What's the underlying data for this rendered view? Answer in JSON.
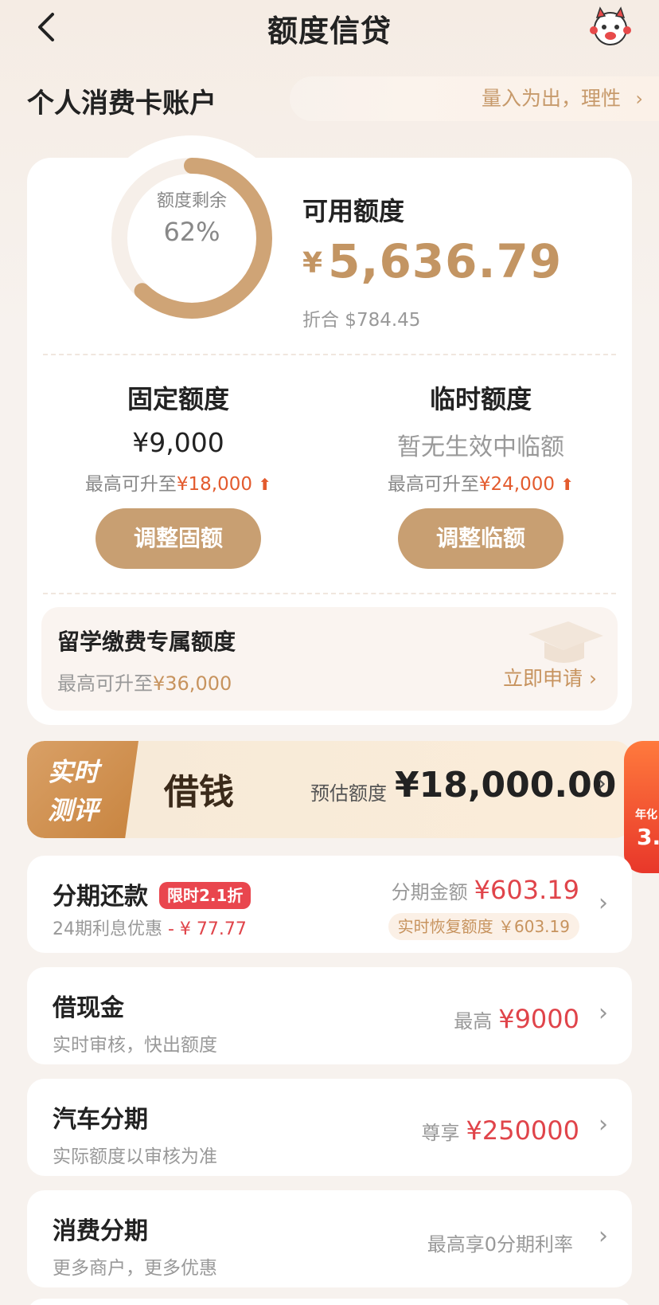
{
  "header": {
    "title": "额度信贷"
  },
  "account": {
    "title": "个人消费卡账户",
    "slogan": "量入为出，理性"
  },
  "credit": {
    "ring_label": "额度剩余",
    "ring_percent": "62%",
    "ring_fraction": 0.62,
    "available_label": "可用额度",
    "currency_symbol": "¥",
    "available_amount": "5,636.79",
    "usd_label": "折合 $784.45",
    "fixed": {
      "title": "固定额度",
      "value": "¥9,000",
      "upto_prefix": "最高可升至",
      "upto_amount": "¥18,000",
      "button": "调整固额"
    },
    "temporary": {
      "title": "临时额度",
      "value": "暂无生效中临额",
      "upto_prefix": "最高可升至",
      "upto_amount": "¥24,000",
      "button": "调整临额"
    },
    "study": {
      "title": "留学缴费专属额度",
      "upto_prefix": "最高可升至",
      "upto_amount": "¥36,000",
      "cta": "立即申请"
    }
  },
  "borrow": {
    "tag_line1": "实时",
    "tag_line2": "测评",
    "name": "借钱",
    "estimate_label": "预估额度",
    "estimate_amount": "¥18,000.00",
    "float_line1": "年化",
    "float_line2": "3."
  },
  "installment": {
    "title": "分期还款",
    "badge": "限时2.1折",
    "sub_prefix": "24期利息优惠",
    "sub_amount": "- ¥ 77.77",
    "right_label": "分期金额",
    "right_amount": "¥603.19",
    "pill": "实时恢复额度 ￥603.19"
  },
  "list": [
    {
      "title": "借现金",
      "sub": "实时审核，快出额度",
      "right_label": "最高",
      "right_amount": "¥9000"
    },
    {
      "title": "汽车分期",
      "sub": "实际额度以审核为准",
      "right_label": "尊享",
      "right_amount": "¥250000"
    },
    {
      "title": "消费分期",
      "sub": "更多商户，更多优惠",
      "right_label": "最高享0分期利率",
      "right_amount": ""
    }
  ],
  "colors": {
    "gold": "#c89f72",
    "red": "#e0444a",
    "orange_red": "#e35b2e"
  }
}
